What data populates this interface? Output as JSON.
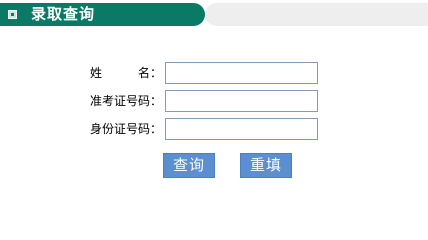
{
  "header": {
    "title": "录取查询",
    "icon": "small-square-icon",
    "colors": {
      "tab": "#0a7a66",
      "tab_rest": "#eeeeee"
    }
  },
  "form": {
    "name": {
      "label_char_1": "姓",
      "label_char_2": "名：",
      "value": ""
    },
    "exam_number": {
      "label": "准考证号码：",
      "value": ""
    },
    "id_number": {
      "label": "身份证号码：",
      "value": ""
    }
  },
  "actions": {
    "query_label": "查询",
    "reset_label": "重填",
    "button_color": "#5b8fcf"
  }
}
